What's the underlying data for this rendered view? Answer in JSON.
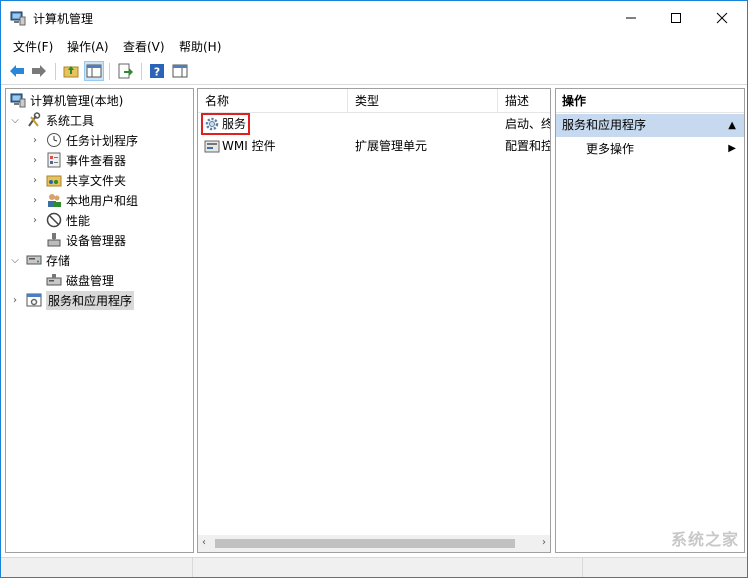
{
  "window": {
    "title": "计算机管理"
  },
  "menu": [
    "文件(F)",
    "操作(A)",
    "查看(V)",
    "帮助(H)"
  ],
  "tree": {
    "root": "计算机管理(本地)",
    "system_tools": "系统工具",
    "task_scheduler": "任务计划程序",
    "event_viewer": "事件查看器",
    "shared_folders": "共享文件夹",
    "local_users": "本地用户和组",
    "performance": "性能",
    "device_manager": "设备管理器",
    "storage": "存储",
    "disk_management": "磁盘管理",
    "services_apps": "服务和应用程序"
  },
  "list": {
    "headers": {
      "name": "名称",
      "type": "类型",
      "desc": "描述"
    },
    "rows": [
      {
        "name": "服务",
        "type": "",
        "desc": "启动、终"
      },
      {
        "name": "WMI 控件",
        "type": "扩展管理单元",
        "desc": "配置和控"
      }
    ]
  },
  "actions": {
    "title": "操作",
    "group": "服务和应用程序",
    "more": "更多操作"
  },
  "watermark": "系统之家"
}
